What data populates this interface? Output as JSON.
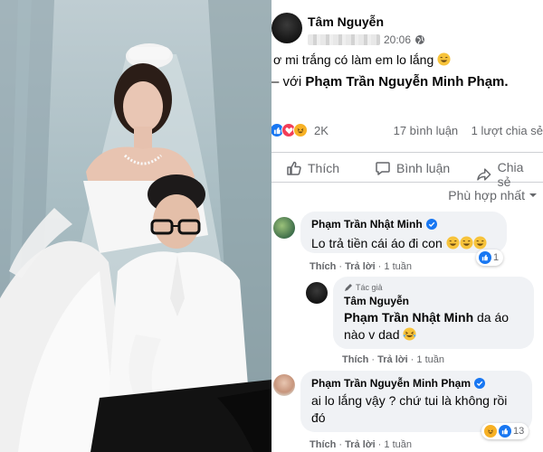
{
  "post": {
    "author": "Tâm Nguyễn",
    "time": "20:06",
    "text": "ơ mi trắng có làm em lo lắng",
    "tag_prefix": "– với",
    "tag_name": "Phạm Trần Nguyễn Minh Phạm.",
    "reaction_count": "2K",
    "comments_count": "17 bình luận",
    "shares_count": "1 lượt chia sẻ"
  },
  "actions": {
    "like": "Thích",
    "comment": "Bình luận",
    "share": "Chia sẻ"
  },
  "sort_label": "Phù hợp nhất",
  "comments": [
    {
      "name": "Phạm Trần Nhật Minh",
      "text": "Lo trả tiền cái áo đi con",
      "like": "Thích",
      "reply": "Trả lời",
      "time": "1 tuần",
      "reaction_count": "1"
    },
    {
      "badge": "Tác giả",
      "name": "Tâm Nguyễn",
      "mention": "Phạm Trần Nhật Minh",
      "text": "da áo nào v dad",
      "like": "Thích",
      "reply": "Trả lời",
      "time": "1 tuần"
    },
    {
      "name": "Phạm Trần Nguyễn Minh Phạm",
      "text_line1": "ai lo lắng vậy ? chứ tui là không rồi",
      "text_line2": "đó",
      "like": "Thích",
      "reply": "Trả lời",
      "time": "1 tuần",
      "reaction_count": "13"
    }
  ],
  "colors": {
    "like_blue": "#1877f2",
    "love_red": "#f33e58",
    "haha_yellow": "#f7b125",
    "muted_gray": "#65676b",
    "bubble_gray": "#f0f2f5"
  },
  "icons": [
    "globe-icon",
    "like-icon",
    "comment-icon",
    "share-icon",
    "verified-icon",
    "caret-down-icon",
    "laugh-emoji-icon",
    "rofl-emoji-icon",
    "love-react-icon",
    "like-react-icon",
    "haha-react-icon"
  ]
}
